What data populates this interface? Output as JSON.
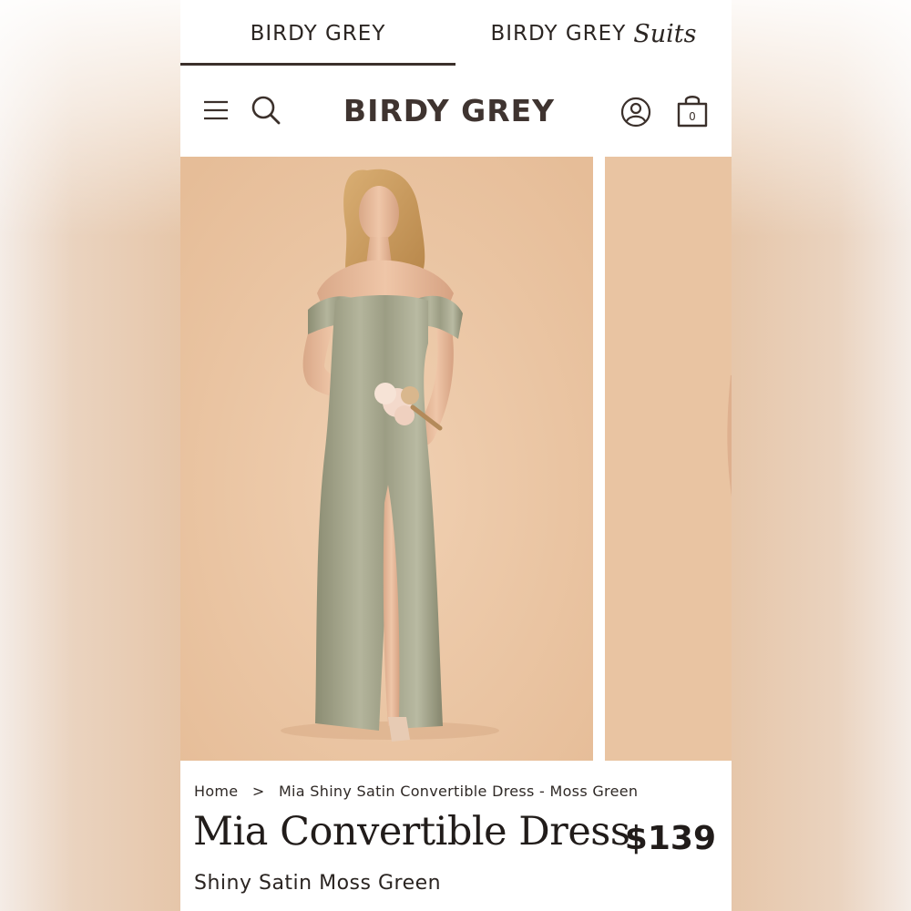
{
  "brand_tabs": [
    {
      "label": "BIRDY GREY",
      "active": true
    },
    {
      "label": "BIRDY GREY",
      "suffix": "Suits",
      "active": false
    }
  ],
  "header": {
    "logo": "BIRDY GREY",
    "cart_count": "0",
    "icons": [
      "menu-icon",
      "search-icon",
      "account-icon",
      "cart-icon"
    ]
  },
  "gallery": {
    "background_color": "#ecc7a5",
    "dress_color": "#9fa088"
  },
  "breadcrumb": {
    "home": "Home",
    "separator": ">",
    "current": "Mia Shiny Satin Convertible Dress - Moss Green"
  },
  "product": {
    "title": "Mia Convertible Dress",
    "price": "$139",
    "subtitle": "Shiny Satin Moss Green"
  }
}
